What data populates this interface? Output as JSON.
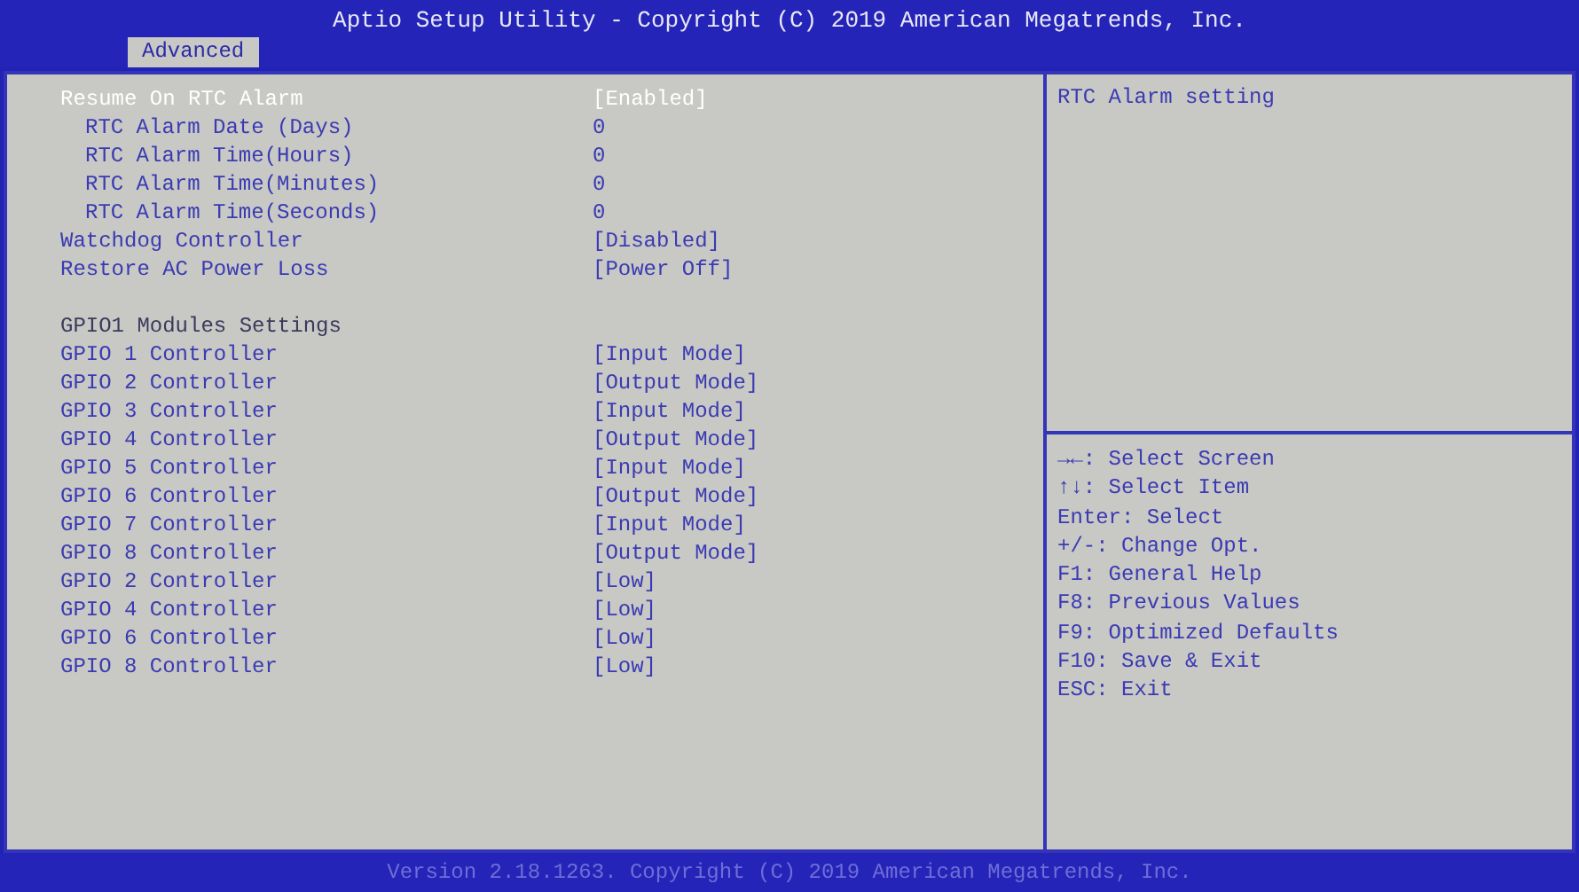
{
  "header": {
    "title": "Aptio Setup Utility - Copyright (C) 2019 American Megatrends, Inc."
  },
  "tabs": [
    {
      "label": "Advanced",
      "selected": true
    }
  ],
  "settings": [
    {
      "kind": "setting",
      "label": "Resume On RTC Alarm",
      "value": "[Enabled]",
      "selected": true,
      "children": [
        {
          "kind": "setting",
          "label": "RTC Alarm Date (Days)",
          "value": "0",
          "selected": false
        },
        {
          "kind": "setting",
          "label": "RTC Alarm Time(Hours)",
          "value": "0",
          "selected": false
        },
        {
          "kind": "setting",
          "label": "RTC Alarm Time(Minutes)",
          "value": "0",
          "selected": false
        },
        {
          "kind": "setting",
          "label": "RTC Alarm Time(Seconds)",
          "value": "0",
          "selected": false
        }
      ]
    },
    {
      "kind": "setting",
      "label": "Watchdog Controller",
      "value": "[Disabled]",
      "selected": false
    },
    {
      "kind": "setting",
      "label": "Restore AC Power Loss",
      "value": "[Power Off]",
      "selected": false
    },
    {
      "kind": "heading",
      "label": "GPIO1 Modules Settings"
    },
    {
      "kind": "setting",
      "label": "GPIO 1 Controller",
      "value": "[Input Mode]",
      "selected": false
    },
    {
      "kind": "setting",
      "label": "GPIO 2 Controller",
      "value": "[Output Mode]",
      "selected": false
    },
    {
      "kind": "setting",
      "label": "GPIO 3 Controller",
      "value": "[Input Mode]",
      "selected": false
    },
    {
      "kind": "setting",
      "label": "GPIO 4 Controller",
      "value": "[Output Mode]",
      "selected": false
    },
    {
      "kind": "setting",
      "label": "GPIO 5 Controller",
      "value": "[Input Mode]",
      "selected": false
    },
    {
      "kind": "setting",
      "label": "GPIO 6 Controller",
      "value": "[Output Mode]",
      "selected": false
    },
    {
      "kind": "setting",
      "label": "GPIO 7 Controller",
      "value": "[Input Mode]",
      "selected": false
    },
    {
      "kind": "setting",
      "label": "GPIO 8 Controller",
      "value": "[Output Mode]",
      "selected": false
    },
    {
      "kind": "setting",
      "label": "GPIO 2 Controller",
      "value": "[Low]",
      "selected": false
    },
    {
      "kind": "setting",
      "label": "GPIO 4 Controller",
      "value": "[Low]",
      "selected": false
    },
    {
      "kind": "setting",
      "label": "GPIO 6 Controller",
      "value": "[Low]",
      "selected": false
    },
    {
      "kind": "setting",
      "label": "GPIO 8 Controller",
      "value": "[Low]",
      "selected": false
    }
  ],
  "help": {
    "text": "RTC Alarm setting"
  },
  "keys": [
    "→←: Select Screen",
    "↑↓: Select Item",
    "Enter: Select",
    "+/-: Change Opt.",
    "F1: General Help",
    "F8: Previous Values",
    "F9: Optimized Defaults",
    "F10: Save & Exit",
    "ESC: Exit"
  ],
  "footer": {
    "text": "Version 2.18.1263. Copyright (C) 2019 American Megatrends, Inc."
  }
}
